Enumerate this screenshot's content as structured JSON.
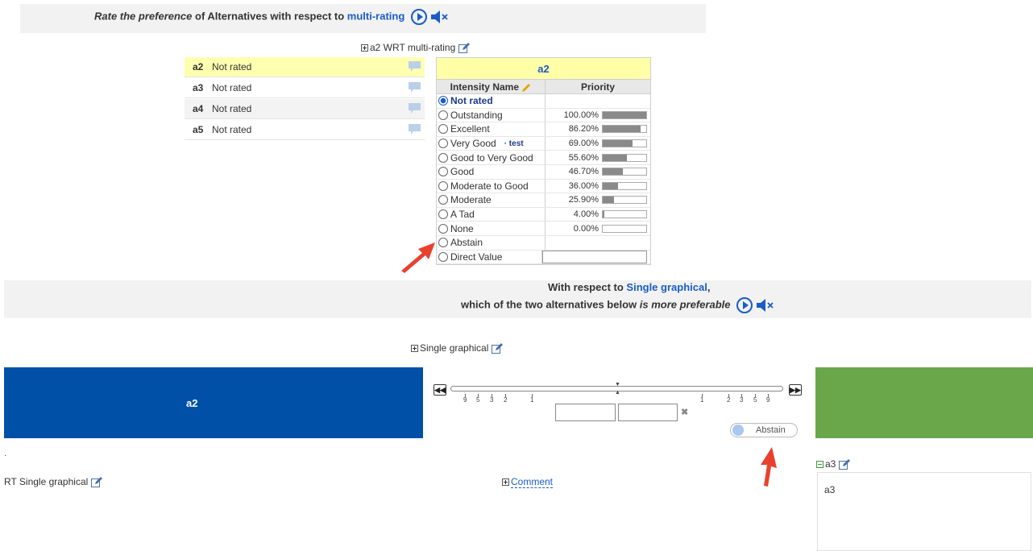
{
  "header1": {
    "prefix": "Rate the preference",
    "middle": " of Alternatives with respect to ",
    "link": "multi-rating"
  },
  "wrt_title": "a2 WRT multi-rating",
  "alternatives": [
    {
      "name": "a2",
      "value": "Not rated"
    },
    {
      "name": "a3",
      "value": "Not rated"
    },
    {
      "name": "a4",
      "value": "Not rated"
    },
    {
      "name": "a5",
      "value": "Not rated"
    }
  ],
  "rating_table": {
    "title": "a2",
    "col_intensity": "Intensity Name",
    "col_priority": "Priority",
    "rows": [
      {
        "name": "Not rated",
        "pct": "",
        "value": null,
        "selected": true
      },
      {
        "name": "Outstanding",
        "pct": "100.00%",
        "value": 1.0
      },
      {
        "name": "Excellent",
        "pct": "86.20%",
        "value": 0.862
      },
      {
        "name": "Very Good",
        "note": "· test",
        "pct": "69.00%",
        "value": 0.69
      },
      {
        "name": "Good to Very Good",
        "pct": "55.60%",
        "value": 0.556
      },
      {
        "name": "Good",
        "pct": "46.70%",
        "value": 0.467
      },
      {
        "name": "Moderate to Good",
        "pct": "36.00%",
        "value": 0.36
      },
      {
        "name": "Moderate",
        "pct": "25.90%",
        "value": 0.259
      },
      {
        "name": "A Tad",
        "pct": "4.00%",
        "value": 0.04
      },
      {
        "name": "None",
        "pct": "0.00%",
        "value": 0.0
      },
      {
        "name": "Abstain",
        "pct": "",
        "value": null
      },
      {
        "name": "Direct Value",
        "pct": "",
        "value": null,
        "input": true
      }
    ]
  },
  "header2": {
    "line1_prefix": "With respect to ",
    "line1_link": "Single graphical",
    "line1_suffix": ",",
    "line2_prefix": "which of the two alternatives below ",
    "line2_em": "is more preferable"
  },
  "single_graphical_title": "Single graphical",
  "left_alt": "a2",
  "slider": {
    "left_ticks": [
      "9",
      "5",
      "3",
      "2",
      "1"
    ],
    "right_ticks": [
      "1",
      "2",
      "3",
      "5",
      "9"
    ]
  },
  "abstain_label": "Abstain",
  "wrt_single": "RT Single graphical",
  "comment_link": "Comment",
  "a3_title": "a3",
  "a3_text": "a3",
  "colors": {
    "accent": "#1a5cc8",
    "left_block": "#0050a8",
    "right_block": "#6aa64a",
    "selected_row": "#ffffb0",
    "arrow": "#e8412e"
  }
}
